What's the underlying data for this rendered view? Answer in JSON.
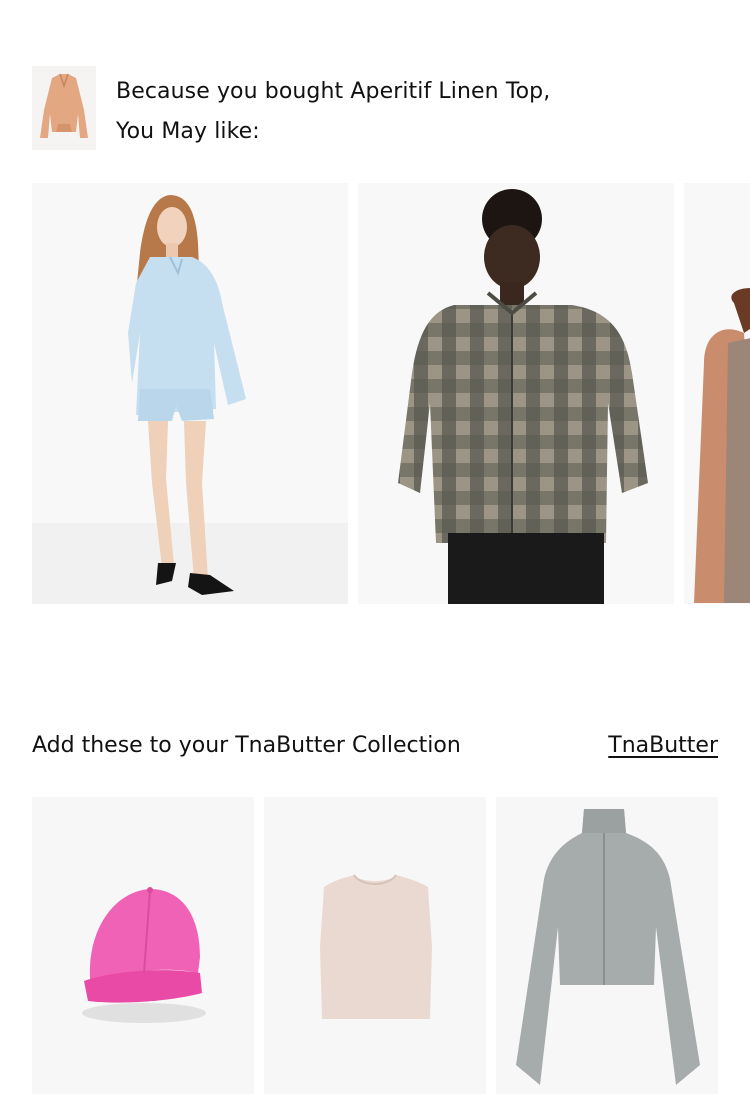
{
  "recommendations": {
    "line1": "Because you bought Aperitif Linen Top,",
    "line2": "You May like:",
    "bought_item_thumbnail": "aperitif-linen-top-image",
    "items": [
      {
        "image": "light-blue-linen-shirt-and-shorts-image"
      },
      {
        "image": "plaid-ruffle-button-blouse-image"
      },
      {
        "image": "taupe-tank-top-image"
      }
    ]
  },
  "collection": {
    "title": "Add these to your TnaButter Collection",
    "link_label": "TnaButter",
    "products": [
      {
        "image": "pink-baseball-cap-image"
      },
      {
        "image": "beige-crop-tank-image"
      },
      {
        "image": "grey-zip-jacket-image"
      }
    ]
  },
  "colors": {
    "card_background": "#f7f7f7",
    "text": "#111111"
  }
}
